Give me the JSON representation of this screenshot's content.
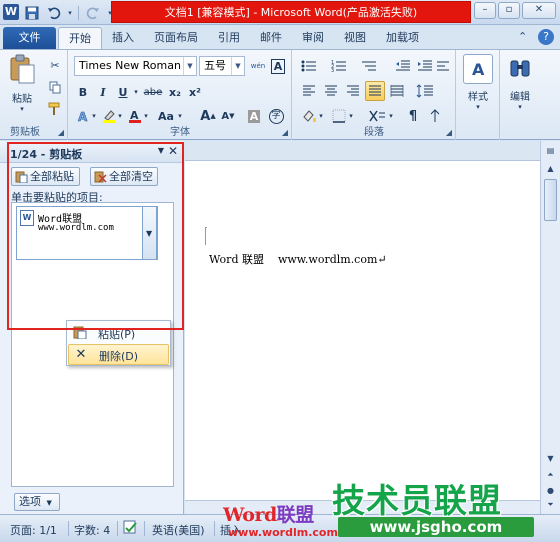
{
  "window": {
    "title": "文档1 [兼容模式] - Microsoft Word(产品激活失败)",
    "app_icon_letter": "W",
    "title_bar_color": "#e3160d"
  },
  "quick_access": {
    "items": [
      "save-icon",
      "undo-icon",
      "redo-icon"
    ]
  },
  "tabs": {
    "file": "文件",
    "items": [
      "开始",
      "插入",
      "页面布局",
      "引用",
      "邮件",
      "审阅",
      "视图",
      "加载项"
    ],
    "active": "开始"
  },
  "ribbon": {
    "clipboard": {
      "paste_label": "粘贴",
      "group_label": "剪贴板"
    },
    "font": {
      "font_name": "Times New Roman",
      "font_size": "五号",
      "wen_label": "wén",
      "bold": "B",
      "italic": "I",
      "underline": "U",
      "strike": "abe",
      "subscript": "x₂",
      "superscript": "x²",
      "grow": "A",
      "change_case": "Aa",
      "group_label": "字体"
    },
    "paragraph": {
      "group_label": "段落"
    },
    "styles": {
      "label": "样式"
    },
    "editing": {
      "label": "编辑"
    }
  },
  "clipboard_pane": {
    "title": "1/24 - 剪贴板",
    "paste_all": "全部粘贴",
    "clear_all": "全部清空",
    "hint": "单击要粘贴的项目:",
    "item": {
      "line1": "Word联盟",
      "line2": "www.wordlm.com"
    },
    "context_menu": {
      "paste": "粘贴(P)",
      "delete": "删除(D)"
    },
    "options": "选项"
  },
  "document": {
    "text": "Word 联盟    www.wordlm.com↵"
  },
  "status_bar": {
    "page": "页面: 1/1",
    "words": "字数: 4",
    "language": "英语(美国)",
    "insert": "插入"
  },
  "watermark": {
    "word": "Word",
    "lianmeng": "联盟",
    "url1": "www.wordlm.com",
    "big": "技术员联盟",
    "url2": "www.jsgho.com"
  }
}
